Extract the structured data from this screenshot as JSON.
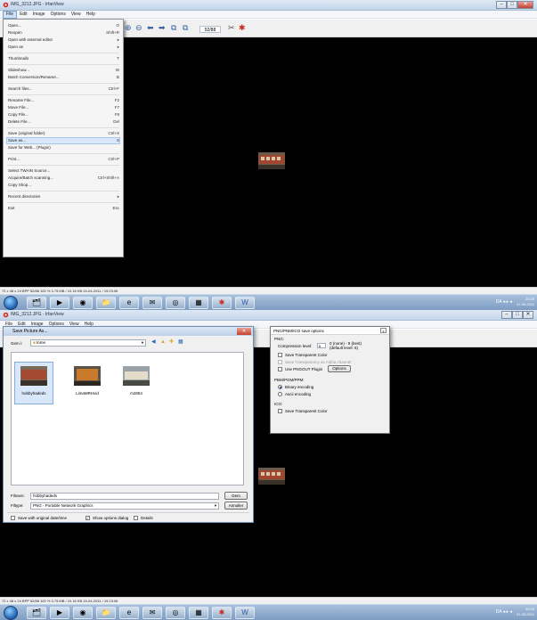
{
  "window": {
    "title": "IMG_3212.JPG - IrfanView",
    "min_label": "–",
    "max_label": "□",
    "close_label": "✕"
  },
  "menu": [
    "File",
    "Edit",
    "Image",
    "Options",
    "View",
    "Help"
  ],
  "toolbar": {
    "counter": "52/88"
  },
  "file_menu": {
    "items": [
      {
        "label": "Open...",
        "shortcut": "O"
      },
      {
        "label": "Reopen",
        "shortcut": "Shift+R"
      },
      {
        "label": "Open with external editor",
        "shortcut": "▸"
      },
      {
        "label": "Open as",
        "shortcut": "▸"
      },
      {
        "label": "Thumbnails",
        "shortcut": "T"
      },
      {
        "label": "Slideshow...",
        "shortcut": "W"
      },
      {
        "label": "Batch Conversion/Rename...",
        "shortcut": "B"
      },
      {
        "label": "Search files...",
        "shortcut": "Ctrl+F"
      },
      {
        "label": "Rename File...",
        "shortcut": "F2"
      },
      {
        "label": "Move File...",
        "shortcut": "F7"
      },
      {
        "label": "Copy File...",
        "shortcut": "F8"
      },
      {
        "label": "Delete File...",
        "shortcut": "Del"
      },
      {
        "label": "Save (original folder)",
        "shortcut": "Ctrl+S"
      },
      {
        "label": "Save as...",
        "shortcut": "S"
      },
      {
        "label": "Save for Web... (Plugin)",
        "shortcut": ""
      },
      {
        "label": "Print...",
        "shortcut": "Ctrl+P"
      },
      {
        "label": "Select TWAIN Source...",
        "shortcut": ""
      },
      {
        "label": "Acquire/Batch scanning...",
        "shortcut": "Ctrl+Shift+A"
      },
      {
        "label": "Copy Shop...",
        "shortcut": ""
      },
      {
        "label": "Recent directories",
        "shortcut": "▸"
      },
      {
        "label": "Exit",
        "shortcut": "Esc"
      }
    ]
  },
  "status": {
    "text": "72 x 48 x 24 BPP     52/88   100 %   3.75 MB / 10.16 KB  24-04-2011 / 19:23:06"
  },
  "taskbar": {
    "tray_text": "DA  ◂ ▸ ◂",
    "clock_time_1": "20:25",
    "clock_date": "01-05-2011",
    "clock_time_2": "20:26"
  },
  "save_dialog": {
    "title": "Save Picture As...",
    "close_label": "✕",
    "location_label": "Gem i:",
    "location_value": "tome",
    "files": [
      {
        "name": "hobbyhadeds"
      },
      {
        "name": "LimaMRHvid"
      },
      {
        "name": "m2854"
      }
    ],
    "filename_label": "Filnavn:",
    "filename_value": "hobbyhadeds",
    "filetype_label": "Filtype:",
    "filetype_value": "PNG - Portable Network Graphics",
    "save_button": "Gem",
    "cancel_button": "Annuller",
    "opt_original_date": "Save with original date/time",
    "opt_show_options": "Show options dialog",
    "opt_details": "Details"
  },
  "png_options": {
    "title": "PNG/PNM/ICO save options",
    "close_label": "x",
    "section_png": "PNG:",
    "compression_label": "Compression level:",
    "compression_value": "6",
    "compression_hint_1": "0 (none) - 9 (best)",
    "compression_hint_2": "(default level: 6)",
    "save_transparent": "Save Transparent Color",
    "save_alpha": "Save Transparency as Alpha channel",
    "use_pngout": "Use PNGOUT Plugin",
    "options_button": "Options",
    "section_pnm": "PBM/PGM/PPM:",
    "binary_encoding": "Binary encoding",
    "ascii_encoding": "Ascii encoding",
    "section_ico": "ICO:",
    "ico_transparent": "Save Transparent Color"
  }
}
